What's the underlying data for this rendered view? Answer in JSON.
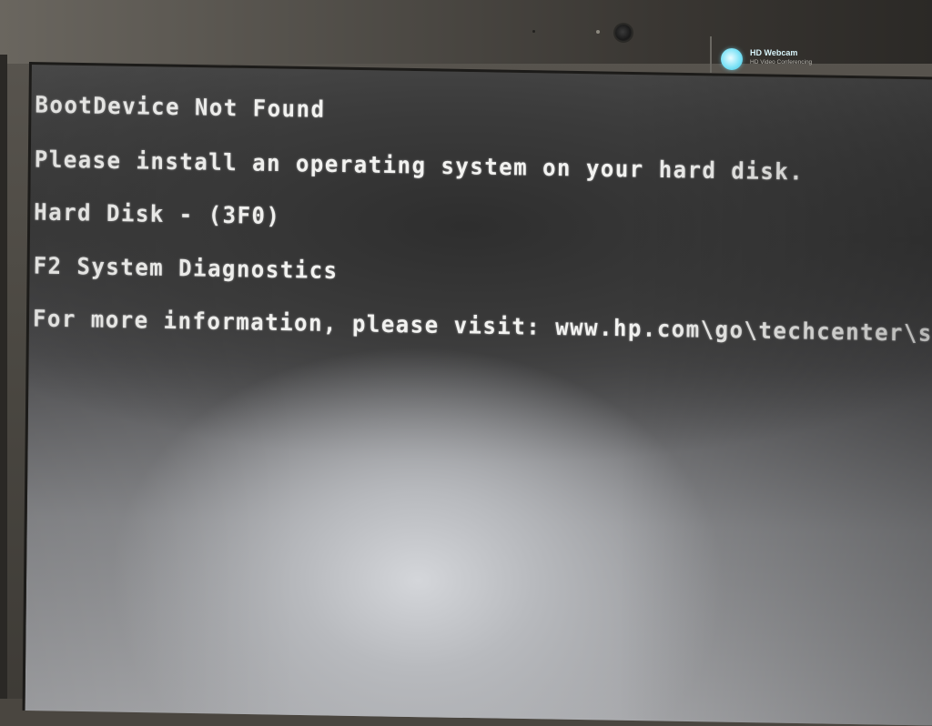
{
  "bezel": {
    "webcam_badge": {
      "title": "HD Webcam",
      "subtitle": "HD Video Conferencing"
    }
  },
  "screen": {
    "lines": [
      "BootDevice Not Found",
      "Please install an operating system on your hard disk.",
      "Hard Disk - (3F0)",
      "F2 System Diagnostics",
      "For more information, please visit: www.hp.com\\go\\techcenter\\startup"
    ]
  },
  "colors": {
    "text": "#f2f2f0",
    "badge_logo": "#7fe3f7"
  }
}
